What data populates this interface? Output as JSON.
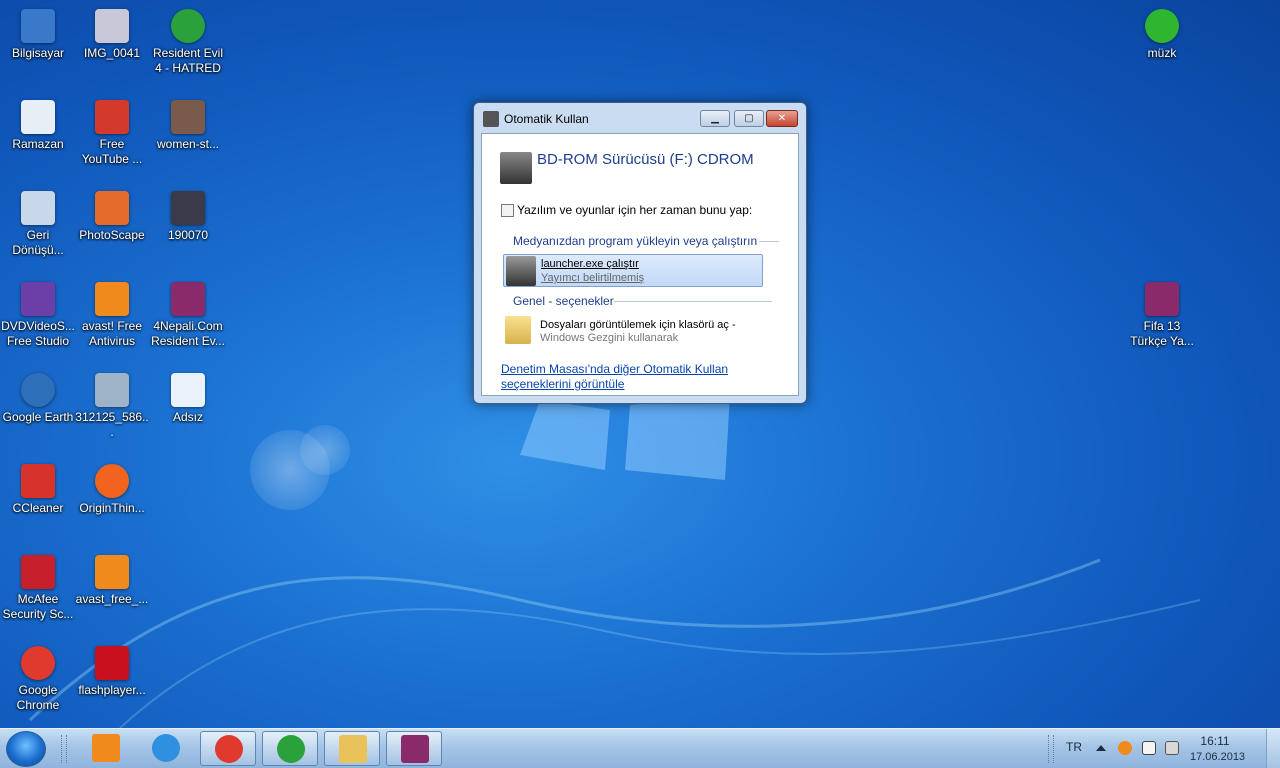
{
  "desktop_icons": [
    {
      "label": "Bilgisayar",
      "icon": "computer-icon",
      "color": "#3a78c9"
    },
    {
      "label": "IMG_0041",
      "icon": "image-file-icon",
      "color": "#c8c8d8"
    },
    {
      "label": "Resident Evil 4 - HATRED",
      "icon": "utorrent-icon",
      "color": "#2aa13a"
    },
    {
      "label": "Ramazan",
      "icon": "document-shortcut-icon",
      "color": "#e8eef6"
    },
    {
      "label": "Free YouTube ...",
      "icon": "free-youtube-icon",
      "color": "#d33a2c"
    },
    {
      "label": "women-st...",
      "icon": "image-file-icon",
      "color": "#7a5a4a"
    },
    {
      "label": "Geri Dönüşü...",
      "icon": "recycle-bin-icon",
      "color": "#c8d7ea"
    },
    {
      "label": "PhotoScape",
      "icon": "photoscape-icon",
      "color": "#e46a2a"
    },
    {
      "label": "190070",
      "icon": "image-file-icon",
      "color": "#3a3a4a"
    },
    {
      "label": "DVDVideoS... Free Studio",
      "icon": "dvdvideosoft-icon",
      "color": "#6b3fa8"
    },
    {
      "label": "avast! Free Antivirus",
      "icon": "avast-icon",
      "color": "#f08a1c"
    },
    {
      "label": "4Nepali.Com Resident Ev...",
      "icon": "winrar-icon",
      "color": "#8a2a6a"
    },
    {
      "label": "Google Earth",
      "icon": "google-earth-icon",
      "color": "#2d6fb8"
    },
    {
      "label": "312125_586...",
      "icon": "image-file-icon",
      "color": "#9fb3c8"
    },
    {
      "label": "Adsız",
      "icon": "image-file-icon",
      "color": "#e9f1fb"
    },
    {
      "label": "CCleaner",
      "icon": "ccleaner-icon",
      "color": "#d8332a"
    },
    {
      "label": "OriginThin...",
      "icon": "origin-icon",
      "color": "#f0641e"
    },
    {
      "label": "McAfee Security Sc...",
      "icon": "mcafee-icon",
      "color": "#c8202a"
    },
    {
      "label": "avast_free_...",
      "icon": "avast-installer-icon",
      "color": "#f08a1c"
    },
    {
      "label": "Google Chrome",
      "icon": "chrome-icon",
      "color": "#e0392d"
    },
    {
      "label": "flashplayer...",
      "icon": "flash-installer-icon",
      "color": "#c8101e"
    },
    {
      "label": "müzk",
      "icon": "media-play-icon",
      "color": "#2fb52f"
    },
    {
      "label": "Fifa 13 Türkçe Ya...",
      "icon": "winrar-icon",
      "color": "#8a2a6a"
    }
  ],
  "dialog": {
    "title": "Otomatik Kullan",
    "minimize_label": "▁",
    "maximize_label": "▢",
    "close_label": "✕",
    "drive_title": "BD-ROM Sürücüsü (F:) CDROM",
    "always_do_label": "Yazılım ve oyunlar için her zaman bunu yap:",
    "always_do_checked": false,
    "section_media": "Medyanızdan program yükleyin veya çalıştırın",
    "run_launcher_title": "launcher.exe çalıştır",
    "run_launcher_sub": "Yayımcı belirtilmemiş",
    "section_general": "Genel - seçenekler",
    "open_folder_title": "Dosyaları görüntülemek için klasörü aç -",
    "open_folder_sub": "Windows Gezgini kullanarak",
    "control_panel_link": "Denetim Masası'nda diğer Otomatik Kullan seçeneklerini görüntüle"
  },
  "taskbar": {
    "pinned": [
      {
        "icon": "media-player-icon",
        "color": "#f08a1c",
        "active": false
      },
      {
        "icon": "internet-explorer-icon",
        "color": "#2f8fe0",
        "active": false
      },
      {
        "icon": "chrome-icon",
        "color": "#e0392d",
        "active": true
      },
      {
        "icon": "utorrent-icon",
        "color": "#2aa13a",
        "active": true
      },
      {
        "icon": "explorer-folder-icon",
        "color": "#e9c25a",
        "active": true
      },
      {
        "icon": "winrar-icon",
        "color": "#8a2a6a",
        "active": true
      }
    ],
    "language": "TR",
    "time": "16:11",
    "date": "17.06.2013"
  }
}
